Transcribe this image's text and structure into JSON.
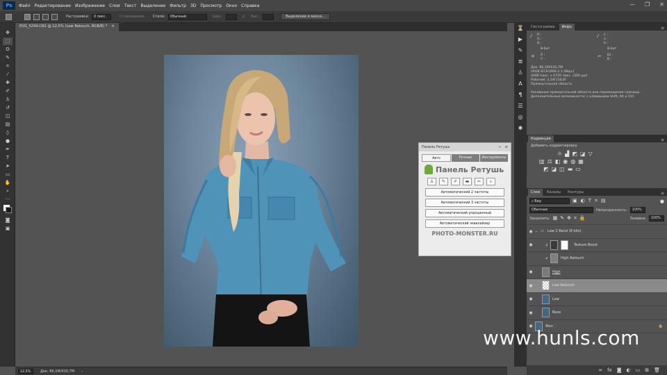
{
  "menu": {
    "logo": "Ps",
    "items": [
      "Файл",
      "Редактирование",
      "Изображение",
      "Слои",
      "Текст",
      "Выделение",
      "Фильтр",
      "3D",
      "Просмотр",
      "Окно",
      "Справка"
    ],
    "win": [
      "—",
      "❐",
      "✕"
    ]
  },
  "options": {
    "feather_label": "Растушевка:",
    "feather_value": "0 пикс.",
    "antialias_label": "Сглаживание",
    "style_label": "Стили:",
    "style_value": "Обычный",
    "width_label": "Шир.:",
    "height_label": "Выс.:",
    "select_mask": "Выделение и маска..."
  },
  "document": {
    "tab_title": "EVG_5249.CR2 @ 12,5% (Low Retouch, RGB/8) *",
    "zoom": "12,5%",
    "doc_size": "Док: 86,1M/430,7M"
  },
  "info_panel": {
    "tabs": [
      "Гистограмма",
      "Инфо"
    ],
    "r": "R :",
    "g": "G :",
    "b": "B :",
    "l": "L :",
    "a": "a :",
    "bb": "b :",
    "bit1": "8-бит",
    "bit2": "8-бит",
    "x": "X :",
    "y": "Y :",
    "w": "Ш :",
    "h": "В :",
    "lines": [
      "Док: 86,1M/430,7M",
      "sRGB IEC61966-2.1 (8bpc)",
      "4480 пикс. x 6720 пикс. (300 ppi)",
      "Рабочий: 2,54Г/18,6Г",
      "Прямоугольная область"
    ],
    "hint1": "Рисование прямоугольной области или перемещение границы.",
    "hint2": "Дополнительные возможности: с клавишами Shift, Alt и Ctrl."
  },
  "corrections": {
    "tab": "Коррекция",
    "add": "Добавить корректировку"
  },
  "layers_panel": {
    "tabs": [
      "Слои",
      "Каналы",
      "Контуры"
    ],
    "filter": "Вид",
    "blend": "Обычные",
    "opacity_label": "Непрозрачность:",
    "opacity": "100%",
    "lock_label": "Закрепить:",
    "fill_label": "Заливка:",
    "fill": "100%",
    "layers": [
      {
        "name": "Low 2 Band (8 bits)",
        "type": "group"
      },
      {
        "name": "Texture Boost",
        "type": "adj"
      },
      {
        "name": "High Retouch",
        "type": "gray"
      },
      {
        "name": "High",
        "type": "gray"
      },
      {
        "name": "Low Retouch",
        "type": "trans",
        "selected": true
      },
      {
        "name": "Low",
        "type": "photo"
      },
      {
        "name": "Base",
        "type": "photo"
      },
      {
        "name": "Фон",
        "type": "photo",
        "locked": true
      }
    ]
  },
  "retouch_panel": {
    "title": "Панель Ретушь",
    "tabs": [
      "Авто",
      "Ручные",
      "Инструменты"
    ],
    "heading": "Панель Ретушь",
    "buttons": [
      "Автоматический 2 частоты",
      "Автоматический 3 частоты",
      "Автоматический упрощенный",
      "Автоматический эквалайзер"
    ],
    "footer": "PHOTO-MONSTER.RU"
  },
  "watermark": "www.hunls.com"
}
